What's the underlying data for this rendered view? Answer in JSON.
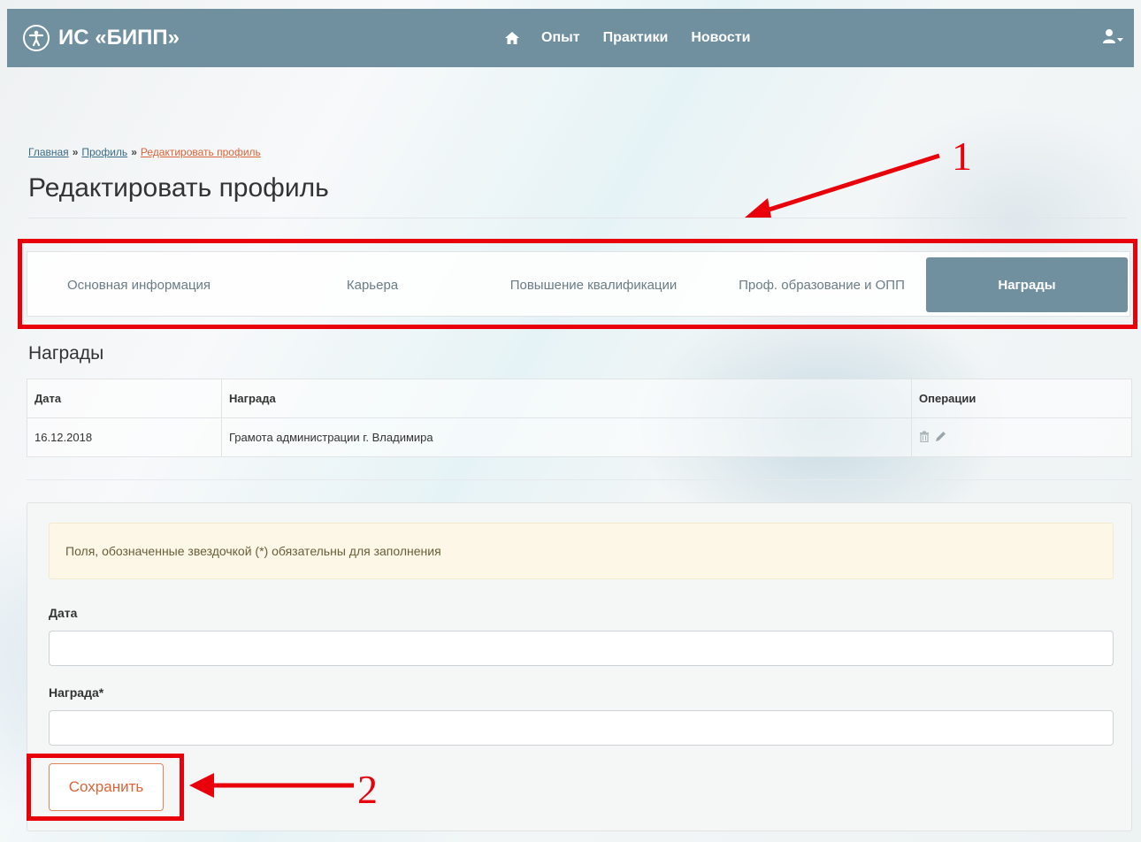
{
  "navbar": {
    "brand": "ИС «БИПП»",
    "home_icon": "home-icon",
    "links": [
      "Опыт",
      "Практики",
      "Новости"
    ],
    "user_icon": "user-icon"
  },
  "breadcrumb": {
    "home": "Главная",
    "separator": "»",
    "profile": "Профиль",
    "current": "Редактировать профиль"
  },
  "page_title": "Редактировать профиль",
  "tabs": [
    {
      "label": "Основная информация",
      "active": false
    },
    {
      "label": "Карьера",
      "active": false
    },
    {
      "label": "Повышение квалификации",
      "active": false
    },
    {
      "label": "Проф. образование и ОПП",
      "active": false
    },
    {
      "label": "Награды",
      "active": true
    }
  ],
  "section_title": "Награды",
  "table": {
    "headers": [
      "Дата",
      "Награда",
      "Операции"
    ],
    "rows": [
      {
        "date": "16.12.2018",
        "award": "Грамота администрации г. Владимира",
        "ops": [
          "delete-icon",
          "edit-icon"
        ]
      }
    ]
  },
  "form": {
    "notice": "Поля, обозначенные звездочкой (*) обязательны для заполнения",
    "date_label": "Дата",
    "date_value": "",
    "award_label": "Награда*",
    "award_value": "",
    "save_label": "Сохранить"
  },
  "annotations": {
    "one": "1",
    "two": "2"
  },
  "colors": {
    "navbar": "#70909f",
    "accent": "#d9643a",
    "annotation": "#e8000b"
  }
}
